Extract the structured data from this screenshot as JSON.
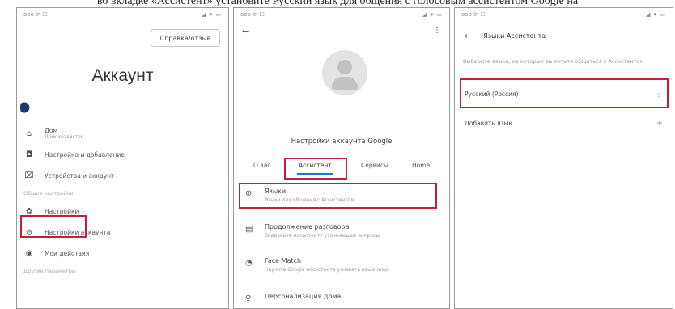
{
  "caption": "во вкладке «Ассистент» установите Русский язык для общения с голосовым ассистентом Google на",
  "phone1": {
    "status_left": "ooo ln ☐",
    "status_right": "◢ ▾ ▭",
    "help_button": "Справка/отзыв",
    "title": "Аккаунт",
    "home_label": "Дом",
    "home_sub": "Домохозяйство",
    "items": [
      {
        "icon": "◘",
        "label": "Настройка и добавление"
      },
      {
        "icon": "⌧",
        "label": "Устройства и аккаунт"
      }
    ],
    "section_label": "Общие настройки",
    "settings_items": [
      {
        "icon": "✿",
        "label": "Настройки"
      },
      {
        "icon": "⊖",
        "label": "Настройки аккаунта"
      },
      {
        "icon": "◉",
        "label": "Мои действия"
      }
    ],
    "footer_label": "Другие параметры"
  },
  "phone2": {
    "status_left": "ooo ln ☐",
    "status_right": "◢ ▾ ▭",
    "back": "←",
    "kebab": "⋮",
    "account_title": "Настройки аккаунта Google",
    "tabs": [
      "О вас",
      "Ассистент",
      "Сервисы",
      "Home"
    ],
    "items": [
      {
        "icon": "⊕",
        "title": "Языки",
        "sub": "Языки для общения с Ассистентом"
      },
      {
        "icon": "▤",
        "title": "Продолжение разговора",
        "sub": "Задавайте Ассистенту уточняющие вопросы"
      },
      {
        "icon": "◔",
        "title": "Face Match",
        "sub": "Научите Google Ассистента узнавать ваше лицо"
      },
      {
        "icon": "♀",
        "title": "Персонализация дома",
        "sub": ""
      }
    ]
  },
  "phone3": {
    "status_left": "ooo ln ☐",
    "status_right": "◢ ▾ ▭",
    "back": "←",
    "header_title": "Языки Ассистента",
    "description": "Выберите языки, на которых вы хотите общаться с Ассистентом",
    "languages": [
      {
        "label": "Русский (Россия)",
        "trail": "⋮"
      },
      {
        "label": "Добавить язык",
        "trail": "+"
      }
    ]
  },
  "highlight_color": "#c41e3a",
  "tab_accent": "#1a73e8"
}
